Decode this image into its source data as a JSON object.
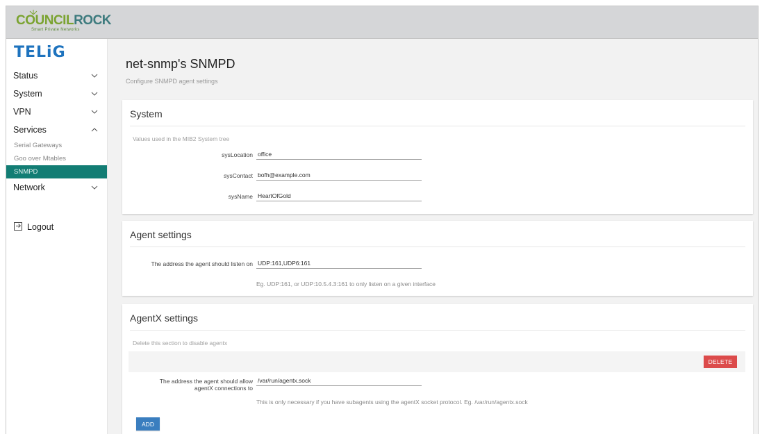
{
  "brand": {
    "name_part1": "COUNCIL",
    "name_part2": "ROCK",
    "tagline": "Smart Private Networks",
    "logo": "TELiG"
  },
  "sidebar": {
    "items": [
      {
        "label": "Status",
        "icon": "chevron-down-icon"
      },
      {
        "label": "System",
        "icon": "chevron-down-icon"
      },
      {
        "label": "VPN",
        "icon": "chevron-down-icon"
      },
      {
        "label": "Services",
        "icon": "chevron-up-icon"
      }
    ],
    "services_sub": [
      {
        "label": "Serial Gateways",
        "active": false
      },
      {
        "label": "Goo over Mtables",
        "active": false
      },
      {
        "label": "SNMPD",
        "active": true
      }
    ],
    "network": {
      "label": "Network",
      "icon": "chevron-down-icon"
    },
    "logout": "Logout"
  },
  "page": {
    "title": "net-snmp's SNMPD",
    "description": "Configure SNMPD agent settings"
  },
  "system_section": {
    "title": "System",
    "description": "Values used in the MIB2 System tree",
    "fields": [
      {
        "label": "sysLocation",
        "value": "office"
      },
      {
        "label": "sysContact",
        "value": "bofh@example.com"
      },
      {
        "label": "sysName",
        "value": "HeartOfGold"
      }
    ]
  },
  "agent_section": {
    "title": "Agent settings",
    "listen_label": "The address the agent should listen on",
    "listen_value": "UDP:161,UDP6:161",
    "listen_help": "Eg. UDP:161, or UDP:10.5.4.3:161 to only listen on a given interface"
  },
  "agentx_section": {
    "title": "AgentX settings",
    "description": "Delete this section to disable agentx",
    "delete_label": "DELETE",
    "allow_label_line1": "The address the agent should allow",
    "allow_label_line2": "agentX connections to",
    "allow_value": "/var/run/agentx.sock",
    "allow_help": "This is only necessary if you have subagents using the agentX socket protocol. Eg. /var/run/agentx.sock",
    "add_label": "ADD"
  },
  "colors": {
    "accent": "#127d74",
    "delete": "#dc4b4b",
    "add": "#3a7ebf",
    "logo_blue": "#1e73be",
    "brand_green": "#7aa330"
  }
}
